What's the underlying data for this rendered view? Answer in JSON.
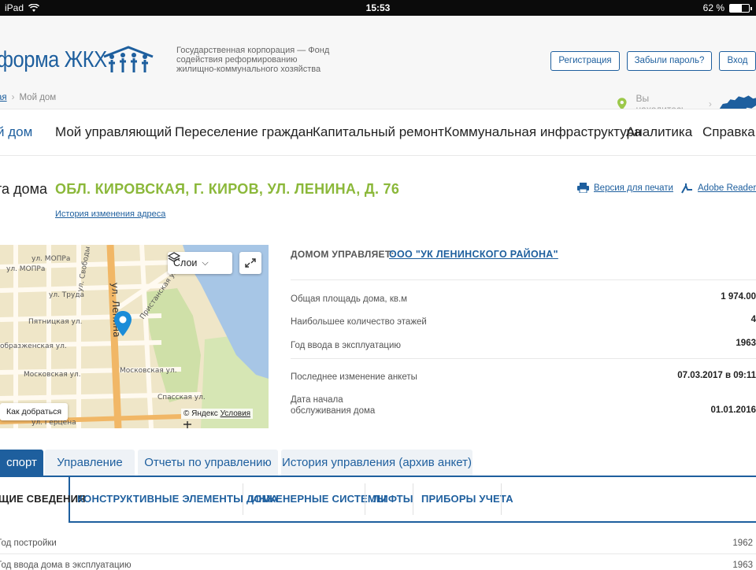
{
  "status_bar": {
    "device": "iPad",
    "time": "15:53",
    "battery": "62 %",
    "battery_level": 0.62
  },
  "header": {
    "logo_text": "форма ЖКХ",
    "org_description": "Государственная корпорация — Фонд содействия реформированию жилищно-коммунального хозяйства",
    "register_label": "Регистрация",
    "forgot_label": "Забыли пароль?",
    "login_label": "Вход",
    "location_label": "Вы находитесь"
  },
  "breadcrumb": {
    "home": "ая",
    "current": "Мой дом"
  },
  "nav": [
    {
      "label": "й дом",
      "active": true
    },
    {
      "label": "Мой управляющий",
      "active": false
    },
    {
      "label": "Переселение граждан",
      "active": false
    },
    {
      "label": "Капитальный ремонт",
      "active": false
    },
    {
      "label": "Коммунальная инфраструктура",
      "active": false
    },
    {
      "label": "Аналитика",
      "active": false
    },
    {
      "label": "Справка",
      "active": false
    }
  ],
  "passport": {
    "title_label": "та дома",
    "address": "ОБЛ. КИРОВСКАЯ, Г. КИРОВ, УЛ. ЛЕНИНА, Д. 76",
    "history_link": "История изменения адреса",
    "print_link": "Версия для печати",
    "adobe_link": "Adobe Reader"
  },
  "map": {
    "layers_label": "Слои",
    "route_label": "Как добраться",
    "copyright": "© Яндекс",
    "terms": "Условия",
    "street_labels": {
      "mopra1": "ул. МОПРа",
      "mopra2": "ул. МОПРа",
      "svobody": "ул. Свободы",
      "truda": "ул. Труда",
      "lenina": "ул. Ленина",
      "pyatnitskaya": "Пятницкая ул.",
      "preobrazhenskaya": "образженская ул.",
      "moskovskaya1": "Московская ул.",
      "moskovskaya2": "Московская ул.",
      "spasskaya": "Спасская ул.",
      "pristanskaya": "Пристанская ул.",
      "gertsena": "ул. Герцена"
    }
  },
  "info": {
    "manager_label": "ДОМОМ УПРАВЛЯЕТ:",
    "manager_value": "ООО \"УК ЛЕНИНСКОГО РАЙОНА\"",
    "rows": [
      {
        "key": "Общая площадь дома, кв.м",
        "value": "1 974.00"
      },
      {
        "key": "Наибольшее количество этажей",
        "value": "4"
      },
      {
        "key": "Год ввода в эксплуатацию",
        "value": "1963"
      },
      {
        "key": "Последнее изменение анкеты",
        "value": "07.03.2017 в 09:11"
      },
      {
        "key": "Дата начала\nобслуживания дома",
        "value": "01.01.2016"
      }
    ]
  },
  "tabs": [
    {
      "label": "спорт",
      "active": true
    },
    {
      "label": "Управление",
      "active": false
    },
    {
      "label": "Отчеты по управлению",
      "active": false
    },
    {
      "label": "История управления (архив анкет)",
      "active": false
    }
  ],
  "subtabs": [
    {
      "label": "ЩИЕ СВЕДЕНИЯ",
      "active": true
    },
    {
      "label": "КОНСТРУКТИВНЫЕ ЭЛЕМЕНТЫ ДОМА",
      "active": false
    },
    {
      "label": "ИНЖЕНЕРНЫЕ СИСТЕМЫ",
      "active": false
    },
    {
      "label": "ЛИФТЫ",
      "active": false
    },
    {
      "label": "ПРИБОРЫ УЧЕТА",
      "active": false
    }
  ],
  "bottom_rows": [
    {
      "key": "Год постройки",
      "value": "1962"
    },
    {
      "key": "Год ввода дома в эксплуатацию",
      "value": "1963"
    }
  ],
  "colors": {
    "brand_blue": "#1e5f9e",
    "address_green": "#8bb83a"
  }
}
